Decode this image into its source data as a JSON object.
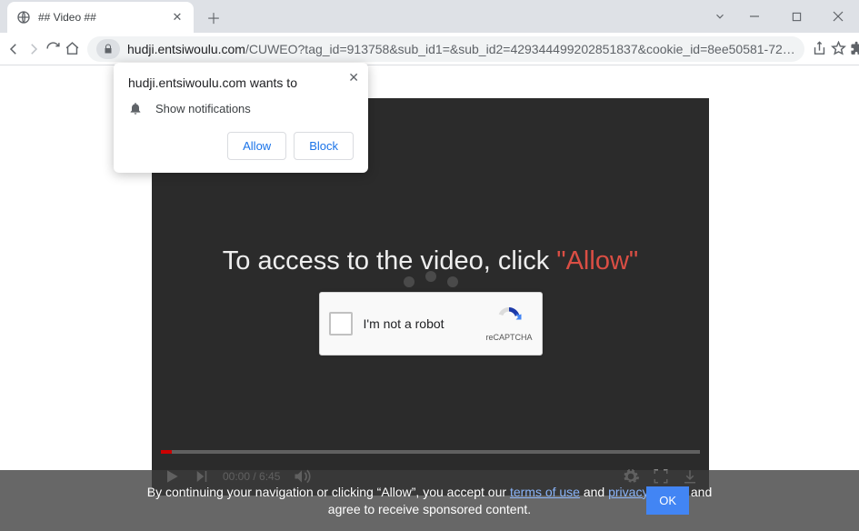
{
  "tab": {
    "title": "## Video ##"
  },
  "url": {
    "host": "hudji.entsiwoulu.com",
    "path": "/CUWEO?tag_id=913758&sub_id1=&sub_id2=429344499202851837&cookie_id=8ee50581-72…"
  },
  "prompt": {
    "origin_text": "hudji.entsiwoulu.com wants to",
    "perm_label": "Show notifications",
    "allow": "Allow",
    "block": "Block"
  },
  "player": {
    "overlay_pre": "To access to the video, click ",
    "overlay_allow": "\"Allow\"",
    "time": "00:00 / 6:45"
  },
  "recaptcha": {
    "label": "I'm not a robot",
    "brand": "reCAPTCHA"
  },
  "cookiebar": {
    "line1_pre": "By continuing your navigation or clicking “Allow”, you accept our ",
    "terms": "terms of use",
    "and1": " and ",
    "privacy": "privacy policy,",
    "line1_post": " and",
    "line2": "agree to receive sponsored content.",
    "ok": "OK"
  }
}
